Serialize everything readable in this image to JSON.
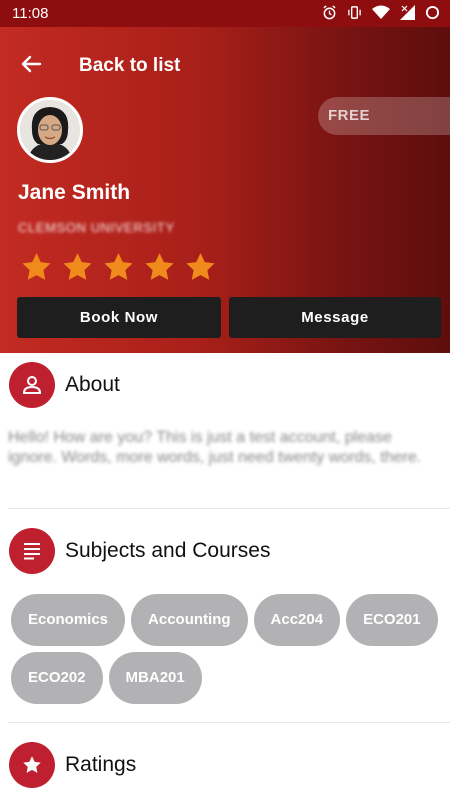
{
  "status_bar": {
    "time": "11:08",
    "icons": [
      "alarm-icon",
      "vibrate-icon",
      "wifi-icon",
      "signal-icon",
      "battery-icon"
    ]
  },
  "header": {
    "back_label": "Back to list",
    "price_badge": "FREE",
    "name": "Jane Smith",
    "university": "CLEMSON UNIVERSITY",
    "rating": 5,
    "rating_max": 5,
    "book_button": "Book Now",
    "message_button": "Message",
    "gradient_colors": [
      "#c22b22",
      "#5e0e0d"
    ]
  },
  "about": {
    "title": "About",
    "text": "Hello! How are you? This is just a test account, please ignore. Words, more words, just need twenty words, there."
  },
  "subjects": {
    "title": "Subjects and Courses",
    "chips": [
      "Economics",
      "Accounting",
      "Acc204",
      "ECO201",
      "ECO202",
      "MBA201"
    ]
  },
  "ratings": {
    "title": "Ratings"
  },
  "colors": {
    "accent": "#be2030",
    "star": "#f08a1c",
    "chip": "#b2b2b5",
    "button": "#1e1e1e"
  }
}
